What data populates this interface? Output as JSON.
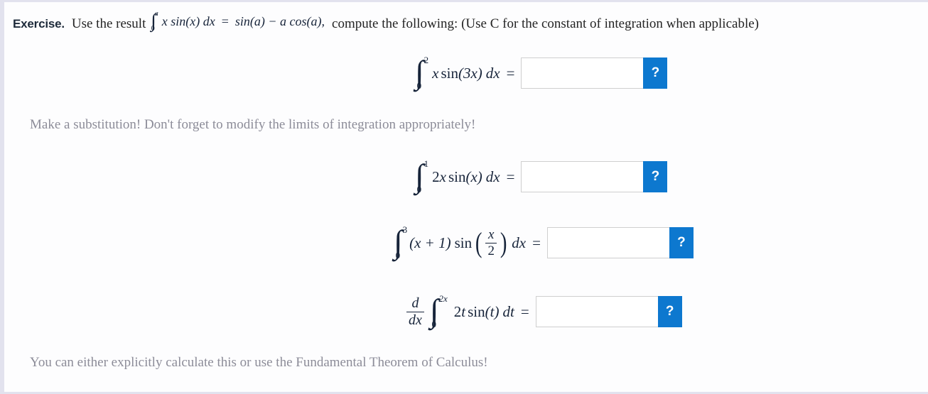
{
  "exercise": {
    "label": "Exercise.",
    "prompt_before": "Use the result",
    "prompt_after": "compute the following: (Use C for the constant of integration when applicable)",
    "given_result": {
      "integral_lower": "0",
      "integral_upper": "a",
      "integrand": "x sin(x) dx",
      "equals": "=",
      "right_side": "sin(a) − a cos(a),"
    }
  },
  "hints": {
    "substitution": "Make a substitution! Don't forget to modify the limits of integration appropriately!",
    "ftc": "You can either explicitly calculate this or use the Fundamental Theorem of Calculus!"
  },
  "answer_widget": {
    "help_label": "?",
    "input_value": "",
    "input_placeholder": ""
  },
  "problems": [
    {
      "id": "problem-1",
      "type": "definite-integral",
      "lower": "0",
      "upper": "2",
      "integrand_parts": {
        "var": "x",
        "func": "sin",
        "arg": "(3x)",
        "differential": "dx"
      },
      "equals": "=",
      "answer": "",
      "help_label": "?"
    },
    {
      "id": "problem-2",
      "type": "definite-integral",
      "lower": "0",
      "upper": "1",
      "integrand_parts": {
        "coeff": "2",
        "var": "x",
        "func": "sin",
        "arg": "(x)",
        "differential": "dx"
      },
      "equals": "=",
      "answer": "",
      "help_label": "?"
    },
    {
      "id": "problem-3",
      "type": "definite-integral",
      "lower": "0",
      "upper": "3",
      "integrand_parts": {
        "factor": "(x + 1)",
        "func": "sin",
        "frac_num": "x",
        "frac_den": "2",
        "differential": "dx"
      },
      "equals": "=",
      "answer": "",
      "help_label": "?"
    },
    {
      "id": "problem-4",
      "type": "derivative-of-integral",
      "operator_num": "d",
      "operator_den": "dx",
      "lower": "0",
      "upper": "2x",
      "integrand_parts": {
        "coeff": "2",
        "var": "t",
        "func": "sin",
        "arg": "(t)",
        "differential": "dt"
      },
      "equals": "=",
      "answer": "",
      "help_label": "?"
    }
  ],
  "colors": {
    "accent_blue": "#0d78cf",
    "math_text": "#17243a",
    "hint_gray": "#8c8c98",
    "input_border": "#cfcfcf",
    "page_border": "#e2e2ee"
  }
}
